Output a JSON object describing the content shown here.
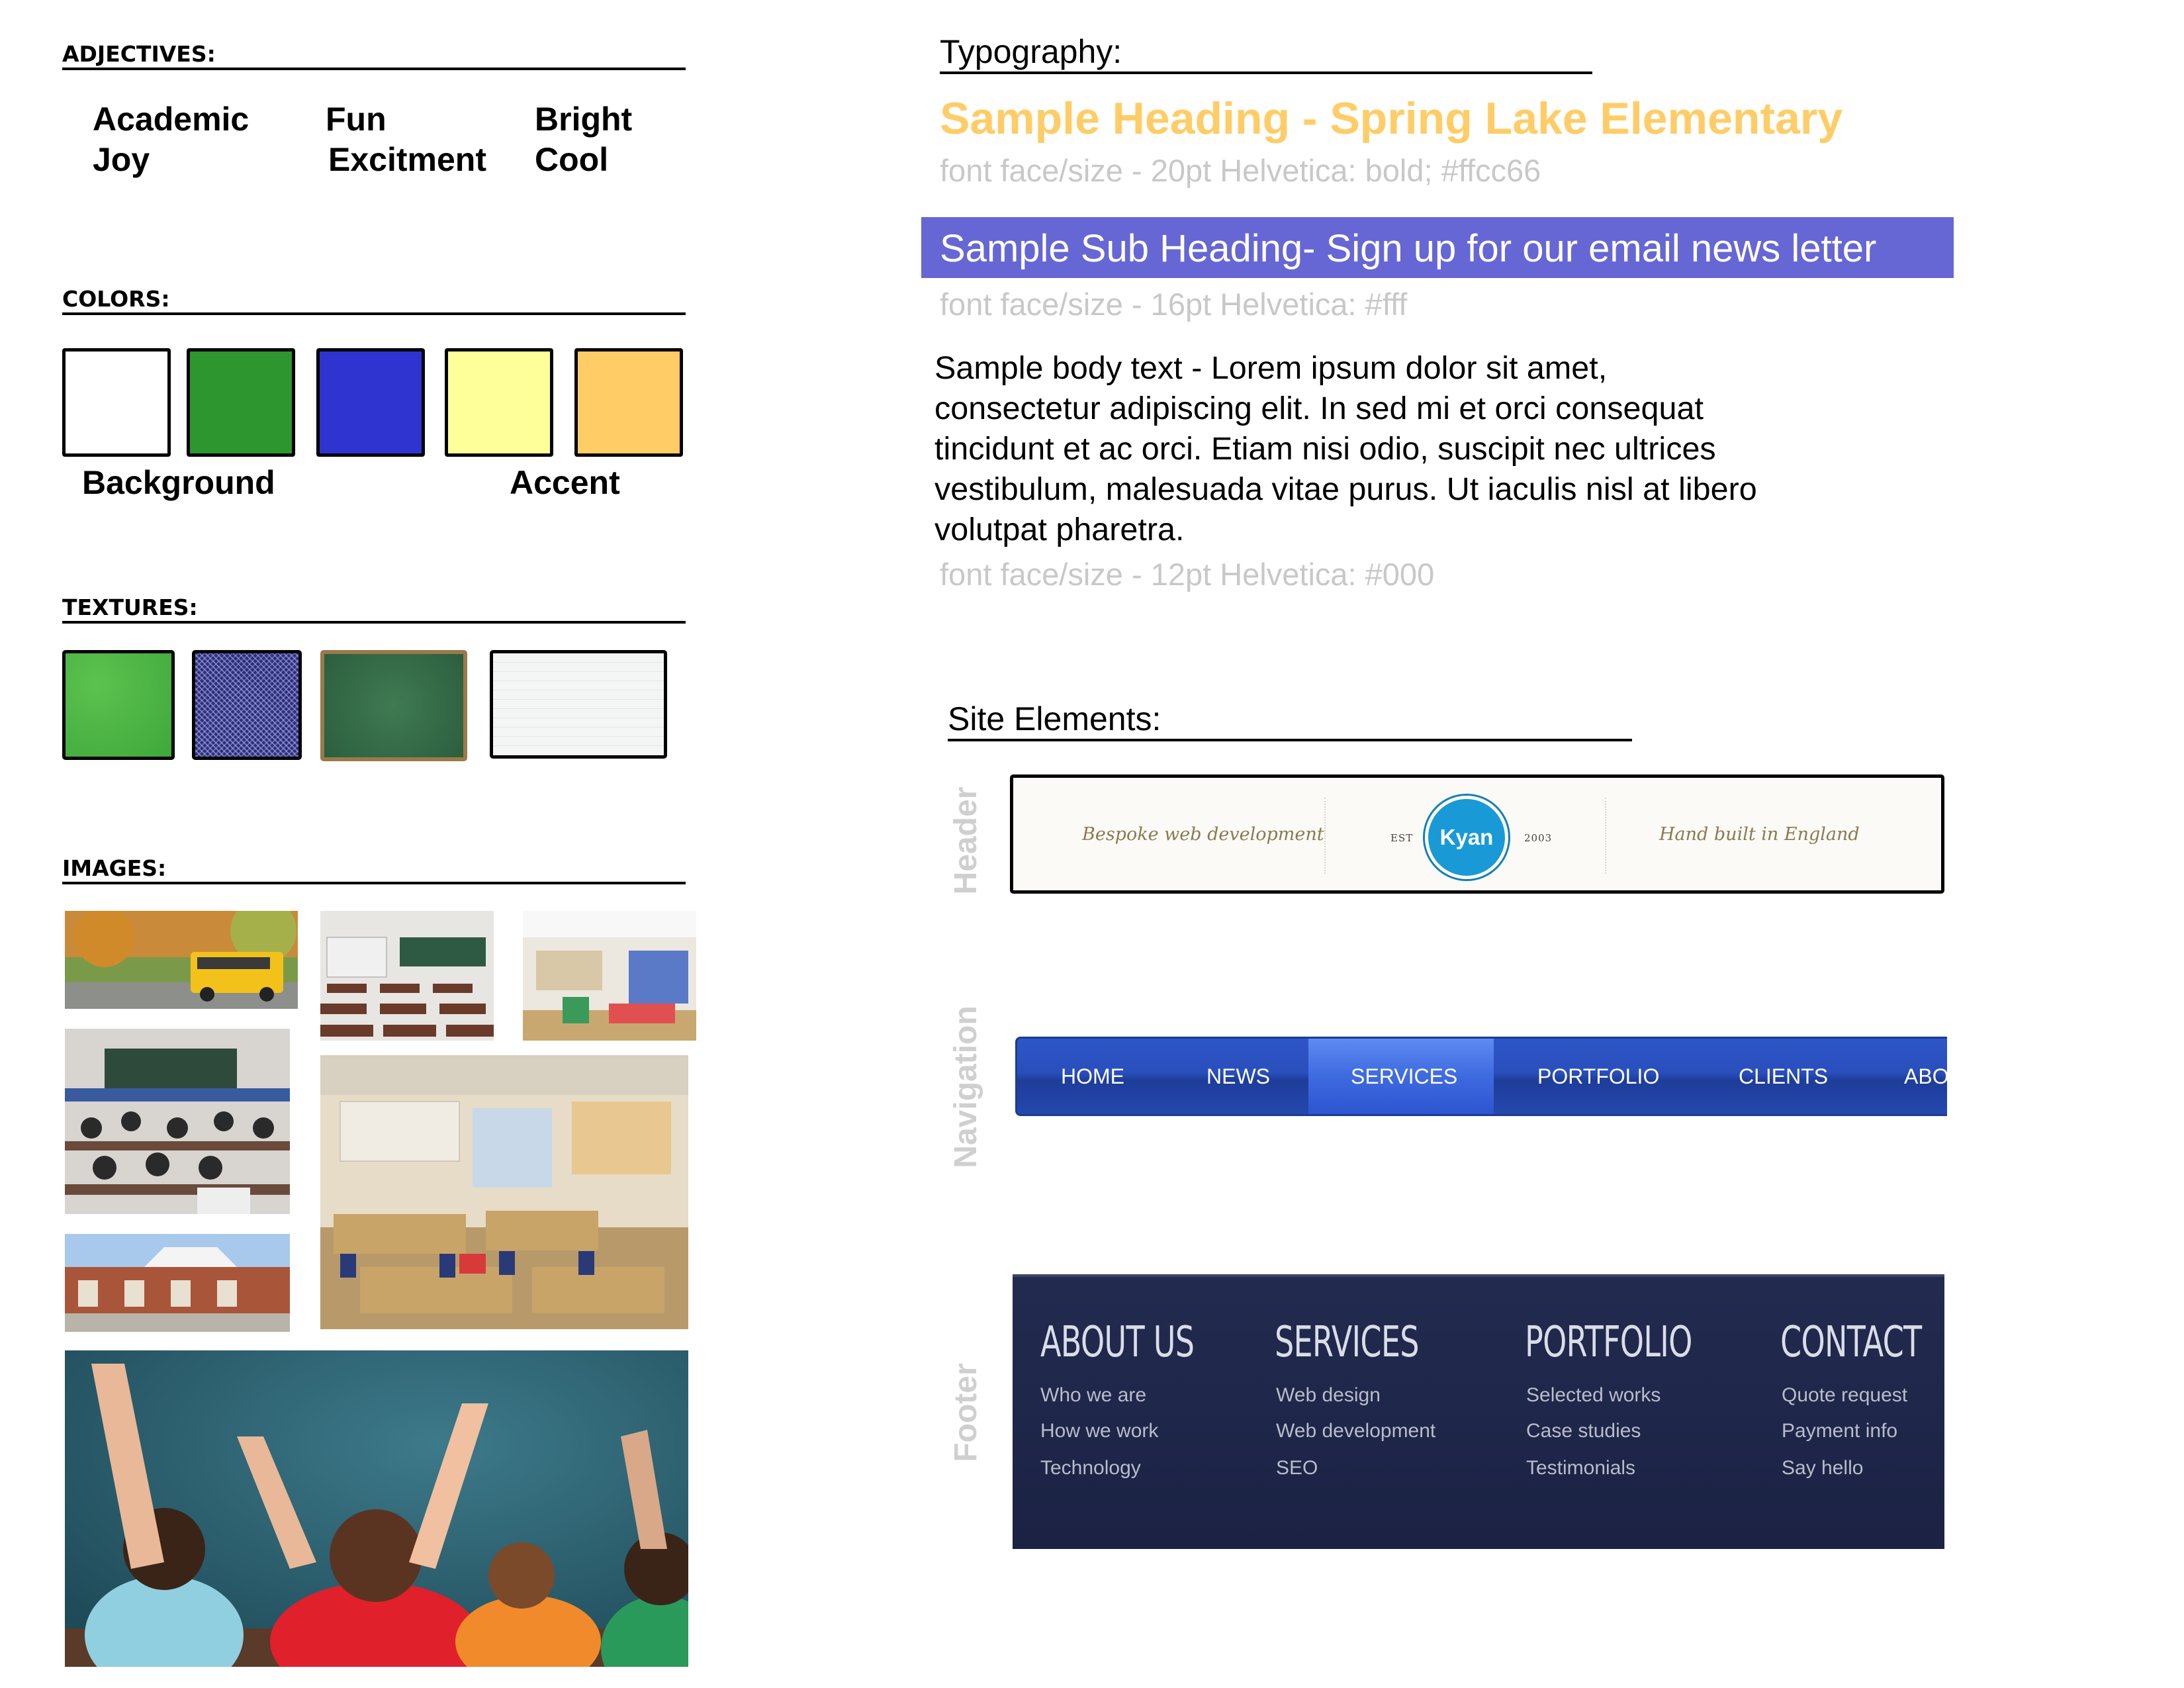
{
  "left": {
    "adjectives": {
      "heading": "ADJECTIVES:",
      "words": [
        "Academic",
        "Fun",
        "Bright",
        "Joy",
        "Excitment",
        "Cool"
      ]
    },
    "colors": {
      "heading": "COLORS:",
      "swatches": [
        "#ffffff",
        "#2e962e",
        "#2f34d1",
        "#ffff99",
        "#ffcc66"
      ],
      "background_label": "Background",
      "accent_label": "Accent"
    },
    "textures": {
      "heading": "TEXTURES:"
    },
    "images": {
      "heading": "IMAGES:"
    }
  },
  "typography": {
    "title": "Typography:",
    "heading_sample": "Sample Heading - Spring Lake Elementary",
    "heading_caption": "font face/size - 20pt Helvetica: bold; #ffcc66",
    "subheading_sample": "Sample Sub Heading- Sign up for our email news letter",
    "subheading_caption": "font face/size - 16pt Helvetica: #fff",
    "body_sample": [
      "Sample body text - Lorem ipsum dolor sit amet,",
      "consectetur adipiscing elit. In sed mi et orci consequat",
      "tincidunt et ac orci. Etiam nisi odio, suscipit nec ultrices",
      "vestibulum, malesuada vitae purus. Ut iaculis nisl at libero",
      "volutpat pharetra."
    ],
    "body_caption": "font face/size - 12pt Helvetica: #000"
  },
  "site_elements": {
    "title": "Site Elements:",
    "header_label": "Header",
    "navigation_label": "Navigation",
    "footer_label": "Footer",
    "header_sample": {
      "left_tag": "Bespoke web development",
      "est": "EST",
      "logo": "Kyan",
      "year": "2003",
      "right_tag": "Hand built in England"
    },
    "nav_sample": {
      "items": [
        "HOME",
        "NEWS",
        "SERVICES",
        "PORTFOLIO",
        "CLIENTS",
        "ABO"
      ],
      "active": "SERVICES"
    },
    "footer_sample": {
      "columns": [
        {
          "heading": "ABOUT US",
          "links": [
            "Who we are",
            "How we work",
            "Technology"
          ]
        },
        {
          "heading": "SERVICES",
          "links": [
            "Web design",
            "Web development",
            "SEO"
          ]
        },
        {
          "heading": "PORTFOLIO",
          "links": [
            "Selected works",
            "Case studies",
            "Testimonials"
          ]
        },
        {
          "heading": "CONTACT",
          "links": [
            "Quote request",
            "Payment info",
            "Say hello"
          ]
        }
      ]
    }
  }
}
